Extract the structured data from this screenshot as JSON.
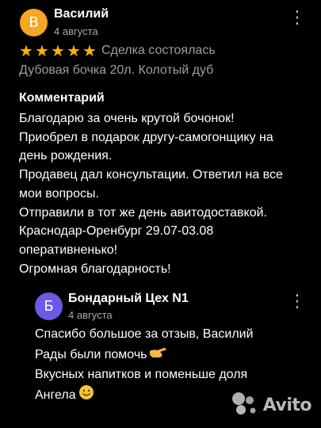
{
  "review": {
    "avatar_letter": "В",
    "author": "Василий",
    "date": "4 августа",
    "rating": 5,
    "status": "Сделка состоялась",
    "product": "Дубовая бочка 20л. Колотый дуб",
    "comment_title": "Комментарий",
    "comment_lines": [
      "Благодарю за очень крутой бочонок!",
      "Приобрел в подарок другу-самогонщику на",
      "день рождения.",
      "Продавец дал консультации. Ответил на все",
      "мои вопросы.",
      "Отправили в тот же день авитодоставкой.",
      "Краснодар-Оренбург 29.07-03.08",
      "оперативненько!",
      "Огромная благодарность!"
    ]
  },
  "reply": {
    "avatar_letter": "Б",
    "author": "Бондарный Цех N1",
    "date": "4 августа",
    "lines": [
      "Спасибо большое за отзыв, Василий",
      "Рады были помочь",
      "Вкусных напитков и поменьше доля",
      "Ангела"
    ]
  },
  "watermark": {
    "text": "Avito"
  },
  "colors": {
    "background": "#000000",
    "star": "#ffb100",
    "avatar_main": "#f5a623",
    "avatar_reply": "#6a5ae6",
    "muted_text": "#9e9e9e"
  },
  "icons": {
    "more": "kebab-menu-icon",
    "star": "star-icon",
    "pointing_hand": "pointing-hand-emoji",
    "smile": "smiling-face-emoji",
    "logo": "avito-logo-icon"
  }
}
